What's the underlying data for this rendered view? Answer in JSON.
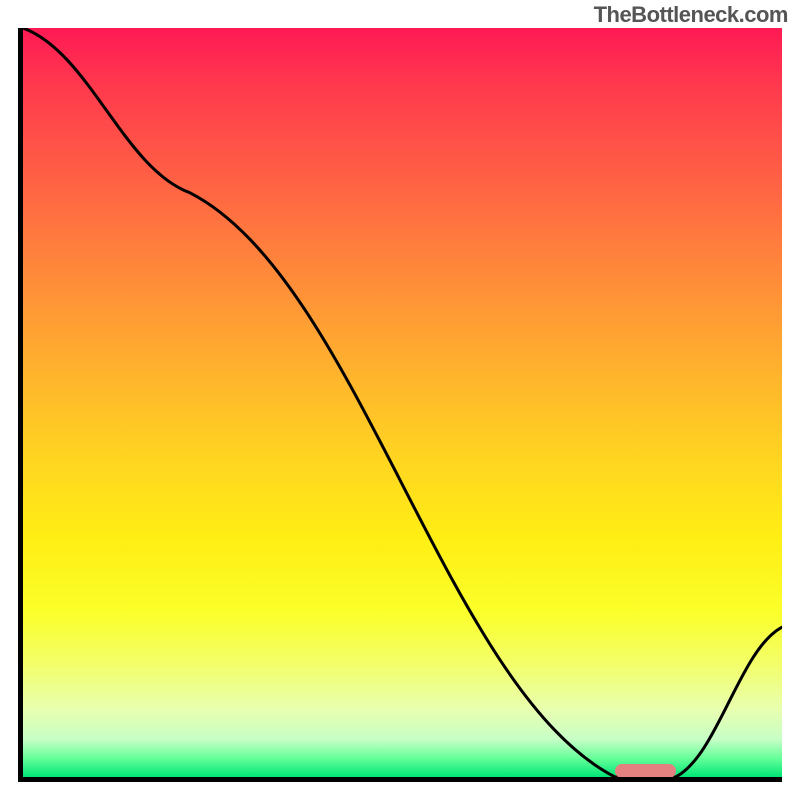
{
  "watermark": "TheBottleneck.com",
  "colors": {
    "gradient_top": "#ff1a54",
    "gradient_mid": "#ffee14",
    "gradient_bottom": "#00e676",
    "axis": "#000000",
    "curve": "#000000",
    "marker": "#e38080",
    "watermark_text": "#555555"
  },
  "chart_data": {
    "type": "line",
    "title": "",
    "xlabel": "",
    "ylabel": "",
    "xlim": [
      0,
      100
    ],
    "ylim": [
      0,
      100
    ],
    "grid": false,
    "x": [
      0,
      22,
      78,
      86,
      100
    ],
    "y": [
      100,
      78,
      0,
      0,
      20
    ],
    "marker": {
      "x_start": 78,
      "x_end": 86,
      "y": 0.8
    },
    "notes": "Axes have no tick labels; y values are read as percent of plot height above the x-axis; x values as percent of plot width from y-axis. Values estimated from pixel positions."
  }
}
